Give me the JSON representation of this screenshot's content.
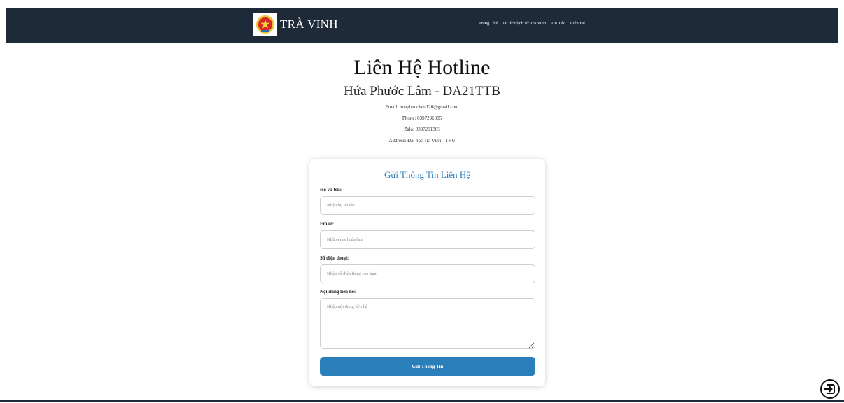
{
  "brand": {
    "name": "TRÀ VINH",
    "logo_icon": "emblem-icon"
  },
  "nav": {
    "items": [
      {
        "label": "Trang Chủ"
      },
      {
        "label": "Di tích lịch sử Trà Vinh"
      },
      {
        "label": "Tin Tức"
      },
      {
        "label": "Liên Hệ"
      }
    ]
  },
  "hero": {
    "title": "Liên Hệ Hotline",
    "subtitle": "Hứa Phước Lâm - DA21TTB",
    "email": "Email: huaphuoclam120@gmail.com",
    "phone": "Phone: 0397291305",
    "zalo": "Zalo: 0397291305",
    "address": "Address: Đại học Trà Vinh - TVU"
  },
  "form": {
    "title": "Gửi Thông Tin Liên Hệ",
    "name_label": "Họ và tên:",
    "name_placeholder": "Nhập họ và tên",
    "email_label": "Email:",
    "email_placeholder": "Nhập email của bạn",
    "phone_label": "Số điện thoại:",
    "phone_placeholder": "Nhập số điện thoại của bạn",
    "message_label": "Nội dung liên hệ:",
    "message_placeholder": "Nhập nội dung liên hệ",
    "submit_label": "Gửi Thông Tin"
  },
  "colors": {
    "navbar": "#1f2a38",
    "accent": "#2a7fba"
  }
}
